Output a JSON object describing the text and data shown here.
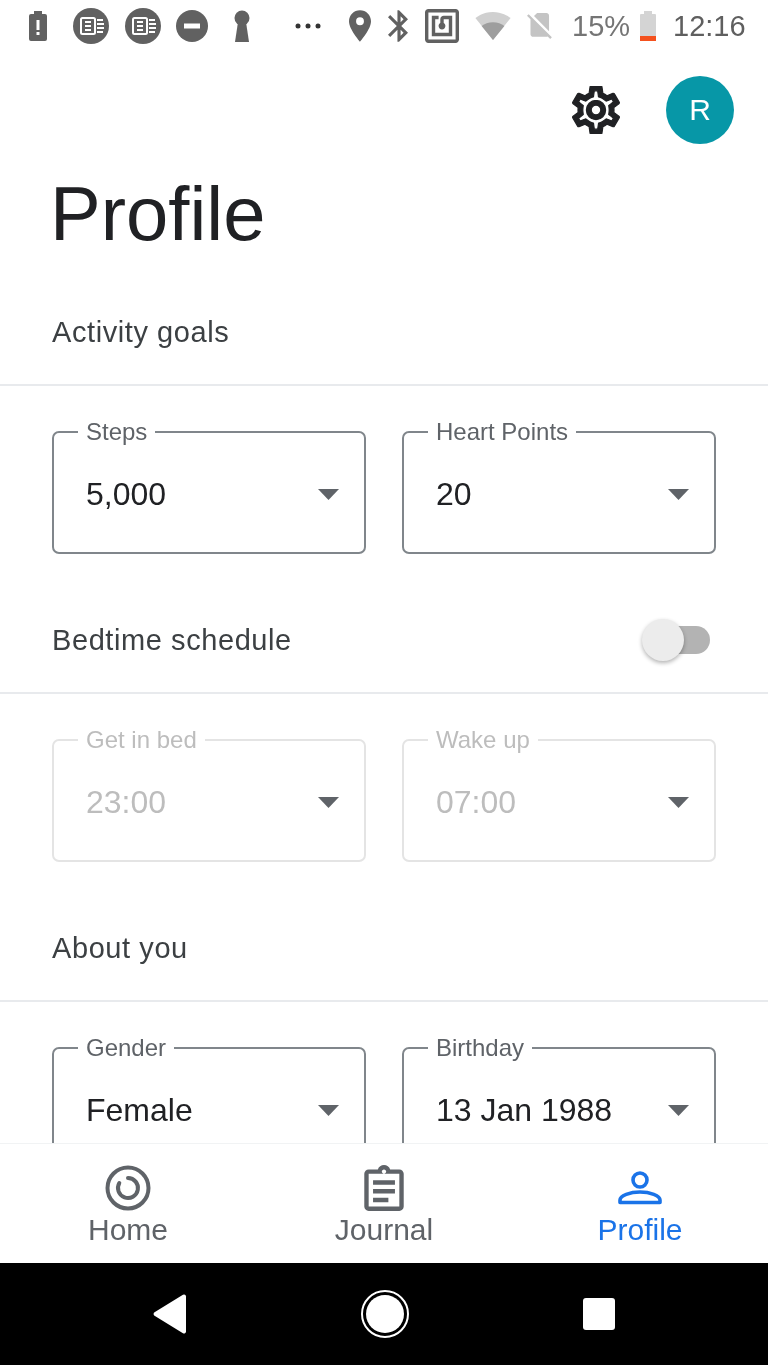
{
  "status_bar": {
    "battery_percent": "15%",
    "time": "12:16"
  },
  "header": {
    "avatar_initial": "R"
  },
  "title": "Profile",
  "sections": [
    {
      "heading": "Activity goals",
      "fields": [
        {
          "label": "Steps",
          "value": "5,000",
          "disabled": false
        },
        {
          "label": "Heart Points",
          "value": "20",
          "disabled": false
        }
      ]
    },
    {
      "heading": "Bedtime schedule",
      "switch": {
        "on": false
      },
      "fields": [
        {
          "label": "Get in bed",
          "value": "23:00",
          "disabled": true
        },
        {
          "label": "Wake up",
          "value": "07:00",
          "disabled": true
        }
      ]
    },
    {
      "heading": "About you",
      "fields": [
        {
          "label": "Gender",
          "value": "Female",
          "disabled": false
        },
        {
          "label": "Birthday",
          "value": "13 Jan 1988",
          "disabled": false
        }
      ]
    }
  ],
  "bottom_nav": {
    "items": [
      {
        "label": "Home",
        "selected": false
      },
      {
        "label": "Journal",
        "selected": false
      },
      {
        "label": "Profile",
        "selected": true
      }
    ]
  }
}
